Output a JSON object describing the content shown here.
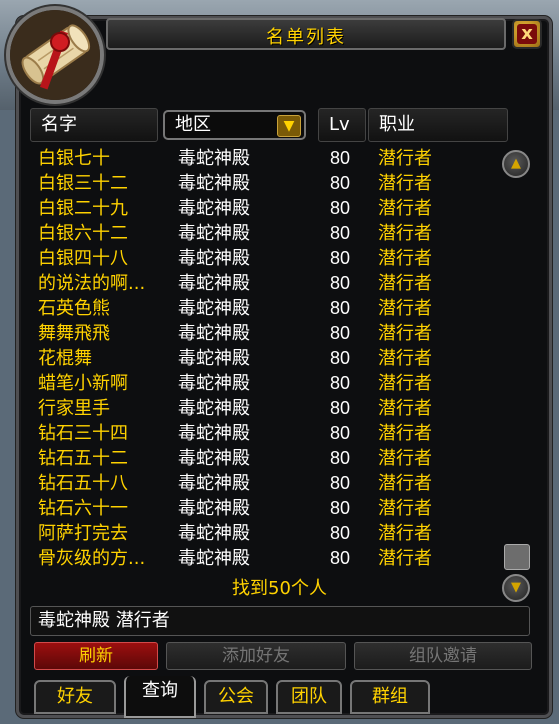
{
  "window": {
    "title": "名单列表",
    "close_label": "x"
  },
  "columns": {
    "name": "名字",
    "zone_dropdown": "地区",
    "level": "Lv",
    "class": "职业"
  },
  "rows": [
    {
      "name": "白银七十",
      "zone": "毒蛇神殿",
      "level": "80",
      "class": "潜行者"
    },
    {
      "name": "白银三十二",
      "zone": "毒蛇神殿",
      "level": "80",
      "class": "潜行者"
    },
    {
      "name": "白银二十九",
      "zone": "毒蛇神殿",
      "level": "80",
      "class": "潜行者"
    },
    {
      "name": "白银六十二",
      "zone": "毒蛇神殿",
      "level": "80",
      "class": "潜行者"
    },
    {
      "name": "白银四十八",
      "zone": "毒蛇神殿",
      "level": "80",
      "class": "潜行者"
    },
    {
      "name": "的说法的啊...",
      "zone": "毒蛇神殿",
      "level": "80",
      "class": "潜行者"
    },
    {
      "name": "石英色熊",
      "zone": "毒蛇神殿",
      "level": "80",
      "class": "潜行者"
    },
    {
      "name": "舞舞飛飛",
      "zone": "毒蛇神殿",
      "level": "80",
      "class": "潜行者"
    },
    {
      "name": "花棍舞",
      "zone": "毒蛇神殿",
      "level": "80",
      "class": "潜行者"
    },
    {
      "name": "蜡笔小新啊",
      "zone": "毒蛇神殿",
      "level": "80",
      "class": "潜行者"
    },
    {
      "name": "行家里手",
      "zone": "毒蛇神殿",
      "level": "80",
      "class": "潜行者"
    },
    {
      "name": "钻石三十四",
      "zone": "毒蛇神殿",
      "level": "80",
      "class": "潜行者"
    },
    {
      "name": "钻石五十二",
      "zone": "毒蛇神殿",
      "level": "80",
      "class": "潜行者"
    },
    {
      "name": "钻石五十八",
      "zone": "毒蛇神殿",
      "level": "80",
      "class": "潜行者"
    },
    {
      "name": "钻石六十一",
      "zone": "毒蛇神殿",
      "level": "80",
      "class": "潜行者"
    },
    {
      "name": "阿萨打完去",
      "zone": "毒蛇神殿",
      "level": "80",
      "class": "潜行者"
    },
    {
      "name": "骨灰级的方...",
      "zone": "毒蛇神殿",
      "level": "80",
      "class": "潜行者"
    }
  ],
  "found_text": "找到50个人",
  "status_text": "毒蛇神殿 潜行者",
  "buttons": {
    "refresh": "刷新",
    "add_friend": "添加好友",
    "group_invite": "组队邀请"
  },
  "tabs": [
    "好友",
    "查询",
    "公会",
    "团队",
    "群组"
  ],
  "active_tab": "查询",
  "colors": {
    "gold": "#ffd200",
    "white": "#ffffff",
    "red_button": "#8a0d0d",
    "panel_bg": "#0d0e10"
  }
}
